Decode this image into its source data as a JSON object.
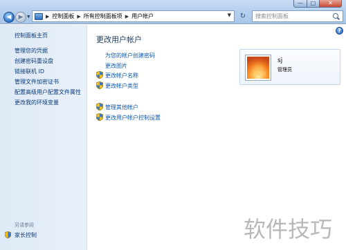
{
  "window": {
    "minimize": "—",
    "maximize": "□",
    "close": "✕"
  },
  "nav": {
    "back_icon": "back-arrow-icon",
    "forward_icon": "forward-arrow-icon",
    "breadcrumb": [
      "控制面板",
      "所有控制面板项",
      "用户帐户"
    ],
    "refresh_icon": "refresh-icon",
    "search_placeholder": "搜索控制面板"
  },
  "sidebar": {
    "home": "控制面板主页",
    "links": [
      "管理您的凭据",
      "创建密码重设盘",
      "链接联机 ID",
      "管理文件加密证书",
      "配置高级用户配置文件属性",
      "更改我的环境变量"
    ],
    "see_also_heading": "另请参阅",
    "see_also": "家长控制"
  },
  "main": {
    "title": "更改用户帐户",
    "tasks_plain": [
      "为您的帐户创建密码",
      "更改图片"
    ],
    "tasks_shield": [
      "更改帐户名称",
      "更改帐户类型"
    ],
    "tasks_other": [
      "管理其他帐户",
      "更改用户帐户控制设置"
    ]
  },
  "user": {
    "name": "sj",
    "role": "管理员"
  },
  "watermark": "软件技巧",
  "colors": {
    "link": "#0b59b3",
    "sidebar_link": "#0b3a75",
    "title": "#1e395b",
    "topbar": "#b6d0ee"
  }
}
